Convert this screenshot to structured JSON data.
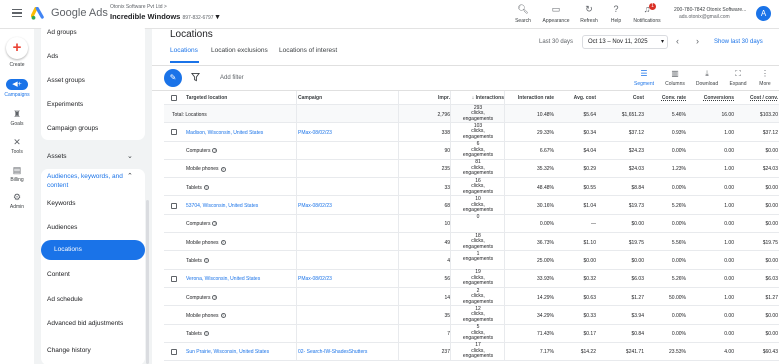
{
  "header": {
    "brand": "Google Ads",
    "account_line1": "Otonix Software Pvt Ltd",
    "account_name": "Incredible Windows",
    "account_number": "897-832-6797",
    "search_label": "Search",
    "appearance_label": "Appearance",
    "refresh_label": "Refresh",
    "help_label": "Help",
    "notifications_label": "Notifications",
    "notifications_count": "1",
    "right_account1": "200-780-7842 Otonix Software...",
    "right_account2": "ads.otonix@gmail.com",
    "avatar_letter": "A"
  },
  "rail": {
    "create": "Create",
    "campaigns": "Campaigns",
    "goals": "Goals",
    "tools": "Tools",
    "billing": "Billing",
    "admin": "Admin"
  },
  "nav": {
    "card1": [
      "Ad groups",
      "Ads",
      "Asset groups",
      "Experiments",
      "Campaign groups"
    ],
    "assets": "Assets",
    "audiences_section": "Audiences, keywords, and content",
    "card2": [
      "Keywords",
      "Audiences",
      "Locations",
      "Content",
      "Ad schedule",
      "Advanced bid adjustments"
    ],
    "change_history": "Change history"
  },
  "main": {
    "title": "Locations",
    "tabs": [
      "Locations",
      "Location exclusions",
      "Locations of interest"
    ],
    "date_label": "Last 30 days",
    "date_range": "Oct 13 – Nov 11, 2025",
    "show_last": "Show last 30 days",
    "add_filter": "Add filter",
    "tools": [
      "Segment",
      "Columns",
      "Download",
      "Expand",
      "More"
    ]
  },
  "table": {
    "headers": [
      "Targeted location",
      "Campaign",
      "Impr.",
      "Interactions",
      "Interaction rate",
      "Avg. cost",
      "Cost",
      "Conv. rate",
      "Conversions",
      "Cost / conv."
    ],
    "total": {
      "label": "Total: Locations",
      "impr": "2,796",
      "interactions": [
        "293",
        "clicks,",
        "engagements"
      ],
      "rate": "10.48%",
      "avg": "$5.64",
      "cost": "$1,651.23",
      "conv_rate": "5.46%",
      "conv": "16.00",
      "cpc": "$103.20"
    },
    "rows": [
      {
        "loc": "Madison, Wisconsin, United States",
        "camp": "PMax-08/02/23",
        "impr": "338",
        "int": [
          "103",
          "clicks,",
          "engagements"
        ],
        "rate": "29.33%",
        "avg": "$0.34",
        "cost": "$37.12",
        "cr": "0.93%",
        "conv": "1.00",
        "cpc": "$37.12",
        "loc_link": true
      },
      {
        "loc": "Computers",
        "camp": "",
        "impr": "90",
        "int": [
          "6",
          "clicks,",
          "engagements"
        ],
        "rate": "6.67%",
        "avg": "$4.04",
        "cost": "$24.23",
        "cr": "0.00%",
        "conv": "0.00",
        "cpc": "$0.00"
      },
      {
        "loc": "Mobile phones",
        "camp": "",
        "impr": "235",
        "int": [
          "81",
          "clicks,",
          "engagements"
        ],
        "rate": "35.32%",
        "avg": "$0.29",
        "cost": "$24.03",
        "cr": "1.23%",
        "conv": "1.00",
        "cpc": "$24.03"
      },
      {
        "loc": "Tablets",
        "camp": "",
        "impr": "33",
        "int": [
          "16",
          "clicks,",
          "engagements"
        ],
        "rate": "48.48%",
        "avg": "$0.55",
        "cost": "$8.84",
        "cr": "0.00%",
        "conv": "0.00",
        "cpc": "$0.00"
      },
      {
        "loc": "53704, Wisconsin, United States",
        "camp": "PMax-08/02/23",
        "impr": "68",
        "int": [
          "10",
          "clicks,",
          "engagements"
        ],
        "rate": "30.16%",
        "avg": "$1.04",
        "cost": "$19.73",
        "cr": "5.26%",
        "conv": "1.00",
        "cpc": "$0.00",
        "loc_link": true
      },
      {
        "loc": "Computers",
        "camp": "",
        "impr": "10",
        "int": [
          "0",
          "",
          ""
        ],
        "rate": "0.00%",
        "avg": "—",
        "cost": "$0.00",
        "cr": "0.00%",
        "conv": "0.00",
        "cpc": "$0.00"
      },
      {
        "loc": "Mobile phones",
        "camp": "",
        "impr": "49",
        "int": [
          "18",
          "clicks,",
          "engagements"
        ],
        "rate": "36.73%",
        "avg": "$1.10",
        "cost": "$19.75",
        "cr": "5.56%",
        "conv": "1.00",
        "cpc": "$19.75"
      },
      {
        "loc": "Tablets",
        "camp": "",
        "impr": "4",
        "int": [
          "1",
          "engagements",
          ""
        ],
        "rate": "25.00%",
        "avg": "$0.00",
        "cost": "$0.00",
        "cr": "0.00%",
        "conv": "0.00",
        "cpc": "$0.00"
      },
      {
        "loc": "Verona, Wisconsin, United States",
        "camp": "PMax-08/02/23",
        "impr": "56",
        "int": [
          "19",
          "clicks,",
          "engagements"
        ],
        "rate": "33.93%",
        "avg": "$0.32",
        "cost": "$6.03",
        "cr": "5.26%",
        "conv": "0.00",
        "cpc": "$6.03",
        "loc_link": true
      },
      {
        "loc": "Computers",
        "camp": "",
        "impr": "14",
        "int": [
          "2",
          "clicks,",
          "engagements"
        ],
        "rate": "14.29%",
        "avg": "$0.63",
        "cost": "$1.27",
        "cr": "50.00%",
        "conv": "1.00",
        "cpc": "$1.27"
      },
      {
        "loc": "Mobile phones",
        "camp": "",
        "impr": "35",
        "int": [
          "12",
          "clicks,",
          "engagements"
        ],
        "rate": "34.29%",
        "avg": "$0.33",
        "cost": "$3.94",
        "cr": "0.00%",
        "conv": "0.00",
        "cpc": "$0.00"
      },
      {
        "loc": "Tablets",
        "camp": "",
        "impr": "7",
        "int": [
          "5",
          "clicks,",
          "engagements"
        ],
        "rate": "71.43%",
        "avg": "$0.17",
        "cost": "$0.84",
        "cr": "0.00%",
        "conv": "0.00",
        "cpc": "$0.00"
      },
      {
        "loc": "Sun Prairie, Wisconsin, United States",
        "camp": "02- Search-IW-ShadesShutters",
        "impr": "237",
        "int": [
          "17",
          "clicks,",
          "engagements"
        ],
        "rate": "7.17%",
        "avg": "$14.22",
        "cost": "$241.71",
        "cr": "23.53%",
        "conv": "4.00",
        "cpc": "$60.43",
        "loc_link": true
      }
    ]
  },
  "colors": {
    "accent": "#1a73e8",
    "text": "#202124",
    "muted": "#5f6368"
  }
}
